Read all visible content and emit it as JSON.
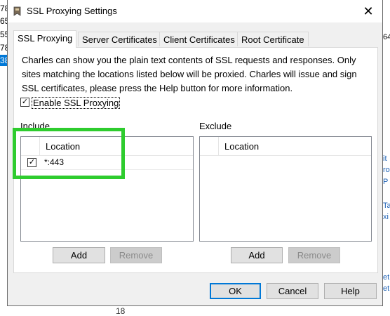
{
  "background": {
    "left_fragments": [
      "78",
      "65",
      "55",
      "78",
      "38"
    ],
    "right_fragments": [
      "64",
      "it",
      "ro",
      "P",
      "Ta",
      "xi",
      "et",
      "et"
    ],
    "bottom_number": "18"
  },
  "dialog": {
    "title": "SSL Proxying Settings",
    "close_glyph": "✕",
    "tabs": [
      {
        "label": "SSL Proxying"
      },
      {
        "label": "Server Certificates"
      },
      {
        "label": "Client Certificates"
      },
      {
        "label": "Root Certificate"
      }
    ],
    "description": "Charles can show you the plain text contents of SSL requests and responses. Only sites matching the locations listed below will be proxied. Charles will issue and sign SSL certificates, please press the Help button for more information.",
    "enable_checkbox": {
      "label": "Enable SSL Proxying",
      "checked": true,
      "glyph": "✓"
    },
    "include": {
      "label": "Include",
      "column_header": "Location",
      "rows": [
        {
          "value": "*:443",
          "checked": true,
          "glyph": "✓"
        }
      ],
      "add_label": "Add",
      "remove_label": "Remove"
    },
    "exclude": {
      "label": "Exclude",
      "column_header": "Location",
      "rows": [],
      "add_label": "Add",
      "remove_label": "Remove"
    },
    "footer": {
      "ok_label": "OK",
      "cancel_label": "Cancel",
      "help_label": "Help"
    },
    "annotation_color": "#2ecc2e"
  }
}
